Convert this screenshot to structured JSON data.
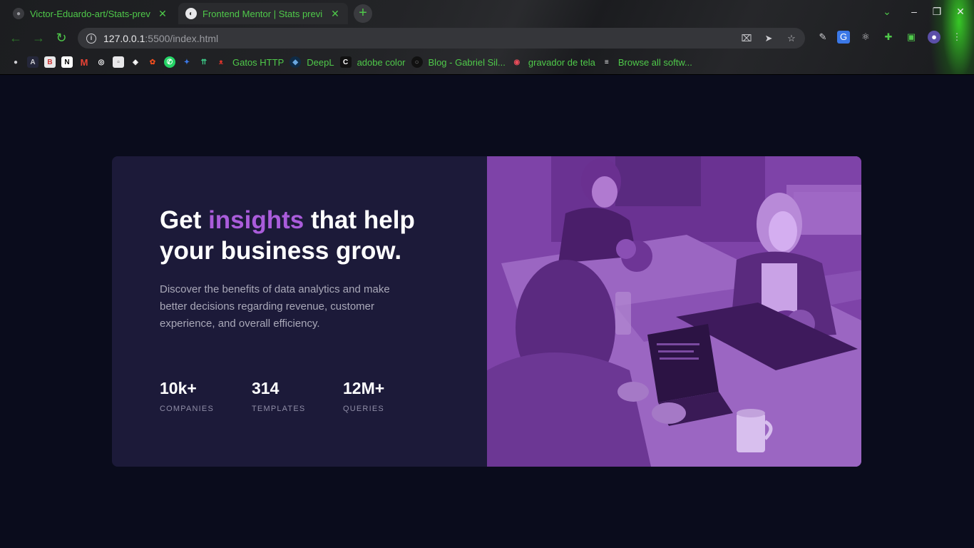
{
  "browser": {
    "tabs": [
      {
        "title": "Victor-Eduardo-art/Stats-prev",
        "favicon": "github-icon",
        "active": false
      },
      {
        "title": "Frontend Mentor | Stats previ",
        "favicon": "frontend-mentor-icon",
        "active": true
      }
    ],
    "new_tab_label": "+",
    "address": {
      "host": "127.0.0.1",
      "path": ":5500/index.html"
    },
    "bookmarks": [
      {
        "icon": "github-icon",
        "label": ""
      },
      {
        "icon": "angular-icon",
        "label": ""
      },
      {
        "icon": "bookmark-icon",
        "label": ""
      },
      {
        "icon": "notion-icon",
        "label": ""
      },
      {
        "icon": "gmail-icon",
        "label": ""
      },
      {
        "icon": "circle-icon",
        "label": ""
      },
      {
        "icon": "page-icon",
        "label": ""
      },
      {
        "icon": "codepen-icon",
        "label": ""
      },
      {
        "icon": "figma-icon",
        "label": ""
      },
      {
        "icon": "whatsapp-icon",
        "label": ""
      },
      {
        "icon": "app-icon",
        "label": ""
      },
      {
        "icon": "arrows-icon",
        "label": ""
      },
      {
        "icon": "cat-icon",
        "label": "Gatos HTTP"
      },
      {
        "icon": "deepl-icon",
        "label": "DeepL"
      },
      {
        "icon": "adobe-color-icon",
        "label": "adobe color"
      },
      {
        "icon": "blog-icon",
        "label": "Blog - Gabriel Sil..."
      },
      {
        "icon": "recorder-icon",
        "label": "gravador de tela"
      },
      {
        "icon": "software-icon",
        "label": "Browse all softw..."
      }
    ]
  },
  "card": {
    "headline_before": "Get ",
    "headline_accent": "insights",
    "headline_after": " that help your business grow.",
    "description": "Discover the benefits of data analytics and make better decisions regarding revenue, customer experience, and overall efficiency.",
    "stats": [
      {
        "value": "10k+",
        "label": "COMPANIES"
      },
      {
        "value": "314",
        "label": "TEMPLATES"
      },
      {
        "value": "12M+",
        "label": "QUERIES"
      }
    ],
    "accent_color": "#aa5cdb",
    "card_color": "#1c1a39",
    "page_color": "#0a0c1c"
  }
}
